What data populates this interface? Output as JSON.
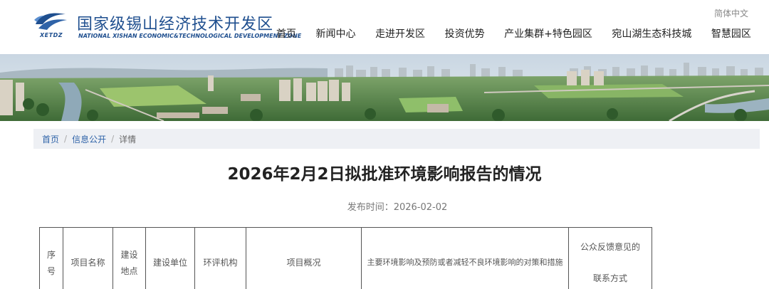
{
  "header": {
    "logo_caption": "XETDZ",
    "site_name": "国家级锡山经济技术开发区",
    "site_name_en": "NATIONAL XISHAN ECONOMIC&TECHNOLOGICAL DEVELOPMENT ZONE",
    "lang_switch": "简体中文",
    "brand_color": "#1f4f8f",
    "nav": [
      {
        "label": "首页"
      },
      {
        "label": "新闻中心"
      },
      {
        "label": "走进开发区"
      },
      {
        "label": "投资优势"
      },
      {
        "label": "产业集群+特色园区"
      },
      {
        "label": "宛山湖生态科技城"
      },
      {
        "label": "智慧园区"
      }
    ]
  },
  "breadcrumb": {
    "items": [
      {
        "label": "首页"
      },
      {
        "label": "信息公开"
      },
      {
        "label": "详情"
      }
    ],
    "link_color": "#2f63a8"
  },
  "article": {
    "title": "2026年2月2日拟批准环境影响报告的情况",
    "publish_label": "发布时间：",
    "publish_date": "2026-02-02"
  },
  "table": {
    "columns": [
      {
        "line1": "序",
        "line2": "号"
      },
      {
        "line1": "项目名称",
        "line2": ""
      },
      {
        "line1": "建设",
        "line2": "地点"
      },
      {
        "line1": "建设单位",
        "line2": ""
      },
      {
        "line1": "环评机构",
        "line2": ""
      },
      {
        "line1": "项目概况",
        "line2": ""
      },
      {
        "line1": "主要环境影响及预防或者减轻不良环境影响的对策和措施",
        "line2": ""
      },
      {
        "line1": "公众反馈意见的",
        "line2": "联系方式"
      }
    ]
  }
}
